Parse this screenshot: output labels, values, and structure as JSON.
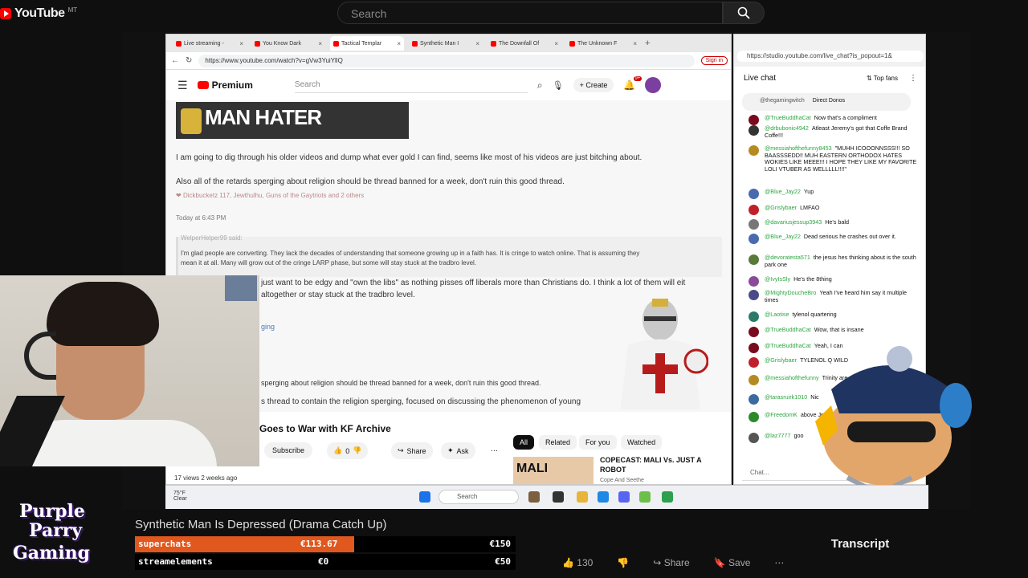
{
  "youtube": {
    "logo_text": "YouTube",
    "region": "MT",
    "search_placeholder": "Search"
  },
  "browser": {
    "tabs": [
      {
        "label": "Live streaming -"
      },
      {
        "label": "You Know Dark"
      },
      {
        "label": "Tactical Templar"
      },
      {
        "label": "Synthetic Man I"
      },
      {
        "label": "The Downfall Of"
      },
      {
        "label": "The Unknown F"
      }
    ],
    "url": "https://www.youtube.com/watch?v=gVw3YuiYllQ",
    "sign_in": "Sign in",
    "inner_logo": "Premium",
    "inner_search": "Search",
    "create_label": "Create",
    "notif_count": "9+"
  },
  "forum": {
    "banner": "MAN HATER",
    "line1": "I am going to dig through his older videos and dump what ever gold I can find, seems like most of his videos are just bitching about.",
    "line2": "Also all of the retards sperging about religion should be thread banned for a week, don't ruin this good thread.",
    "reactions": "Dickbucketz 117, Jewthulhu, Guns of the Gaytriots and 2 others",
    "timestamp": "Today at 6:43 PM",
    "quote_author": "WelperHelper99 said:",
    "quote_text1": "I'm glad people are converting. They lack the decades of understanding that someone growing up in a faith has. It is cringe to watch online. That is assuming they",
    "quote_text2": "mean it at all. Many will grow out of the cringe LARP phase, but some will stay stuck at the tradbro level.",
    "reply1": "just want to be edgy and \"own the libs\" as nothing pisses off liberals more than Christians do. I think a lot of them will eit",
    "reply2": "altogether or stay stuck at the tradbro level.",
    "link_text": "ging",
    "reply3": "sperging about religion should be thread banned for a week, don't ruin this good thread.",
    "reply4": "s thread to contain the religion sperging, focused on discussing the phenomenon of young"
  },
  "video": {
    "title": "Goes to War with KF Archive",
    "subscribe": "Subscribe",
    "likes": "0",
    "share": "Share",
    "ask": "Ask",
    "chips": [
      "All",
      "Related",
      "For you",
      "Watched"
    ],
    "related_thumb": "MALI",
    "related_title": "COPECAST: MALI Vs. JUST A ROBOT",
    "related_channel": "Cope And Seethe",
    "views": "17 views  2 weeks ago"
  },
  "chat": {
    "url": "https://studio.youtube.com/live_chat?is_popout=1&",
    "title": "Live chat",
    "filter": "Top fans",
    "pinned_user": "@thegamingwitch",
    "pinned_text": "Direct Donos",
    "input_placeholder": "Chat...",
    "messages": [
      {
        "user": "@TrueBuddhaCat",
        "text": "Now that's a compliment",
        "color": "#7a0a1e"
      },
      {
        "user": "@drbubonic4942",
        "text": "Atleast Jeremy's got that Coffe Brand Coffe!!!",
        "color": "#333333"
      },
      {
        "user": "@messiahofthefunny8453",
        "text": "\"MUHH ICOOONNSSS!!! SO BAASSSEDD!! MUH EASTERN ORTHODOX HATES WOKIES LIKE MEEE!!! I HOPE THEY LIKE MY FAVORITE LOLI VTUBER AS WELLLLL!!!!\"",
        "color": "#b58a20"
      },
      {
        "user": "@Blue_Jay22",
        "text": "Yup",
        "color": "#4a6ab0"
      },
      {
        "user": "@Grislybaer",
        "text": "LMFAO",
        "color": "#c0202a"
      },
      {
        "user": "@davariusjessup3943",
        "text": "He's bald",
        "color": "#777777"
      },
      {
        "user": "@Blue_Jay22",
        "text": "Dead serious he crashes out over it.",
        "color": "#4a6ab0"
      },
      {
        "user": "@devoratesta571",
        "text": "the jesus hes thinking about is the south park one",
        "color": "#5a7a3a"
      },
      {
        "user": "@IvyIsSly",
        "text": "He's the 8thing",
        "color": "#8a4a9a"
      },
      {
        "user": "@MightyDoucheBro",
        "text": "Yeah I've heard him say it multiple times",
        "color": "#4a4a8a"
      },
      {
        "user": "@Laotise",
        "text": "tylenol quartering",
        "color": "#2a7a6a"
      },
      {
        "user": "@TrueBuddhaCat",
        "text": "Wow, that is insane",
        "color": "#7a0a1e"
      },
      {
        "user": "@TrueBuddhaCat",
        "text": "Yeah, I can",
        "color": "#7a0a1e"
      },
      {
        "user": "@Grislybaer",
        "text": "TYLENOL Q WILD",
        "color": "#c0202a"
      },
      {
        "user": "@messiahofthefunny",
        "text": "Trinity are parts of God",
        "color": "#b58a20"
      },
      {
        "user": "@tarasruirk1010",
        "text": "Nic",
        "color": "#3a6aa0"
      },
      {
        "user": "@FreedomK",
        "text": "above Jerem 5 mins",
        "color": "#2a8a2a"
      },
      {
        "user": "@laz7777",
        "text": "goo",
        "color": "#555555"
      }
    ]
  },
  "taskbar": {
    "weather_temp": "75°F",
    "weather_desc": "Clear",
    "search": "Search"
  },
  "overlay": {
    "logo_line1": "Purple",
    "logo_line2": "Parry",
    "logo_line3": "Gaming",
    "stream_title": "Synthetic Man Is Depressed (Drama Catch Up)",
    "bar1_label": "superchats",
    "bar1_value": "€113.67",
    "bar1_goal": "€150",
    "bar1_progress": 0.758,
    "bar2_label": "streamelements",
    "bar2_value": "€0",
    "bar2_goal": "€50",
    "bar2_progress": 0,
    "transcript": "Transcript",
    "like_count": "130",
    "share": "Share",
    "save": "Save",
    "colors": {
      "bar1": "#e0581e",
      "bar_bg": "#000000",
      "brand_red": "#ff0000"
    }
  }
}
